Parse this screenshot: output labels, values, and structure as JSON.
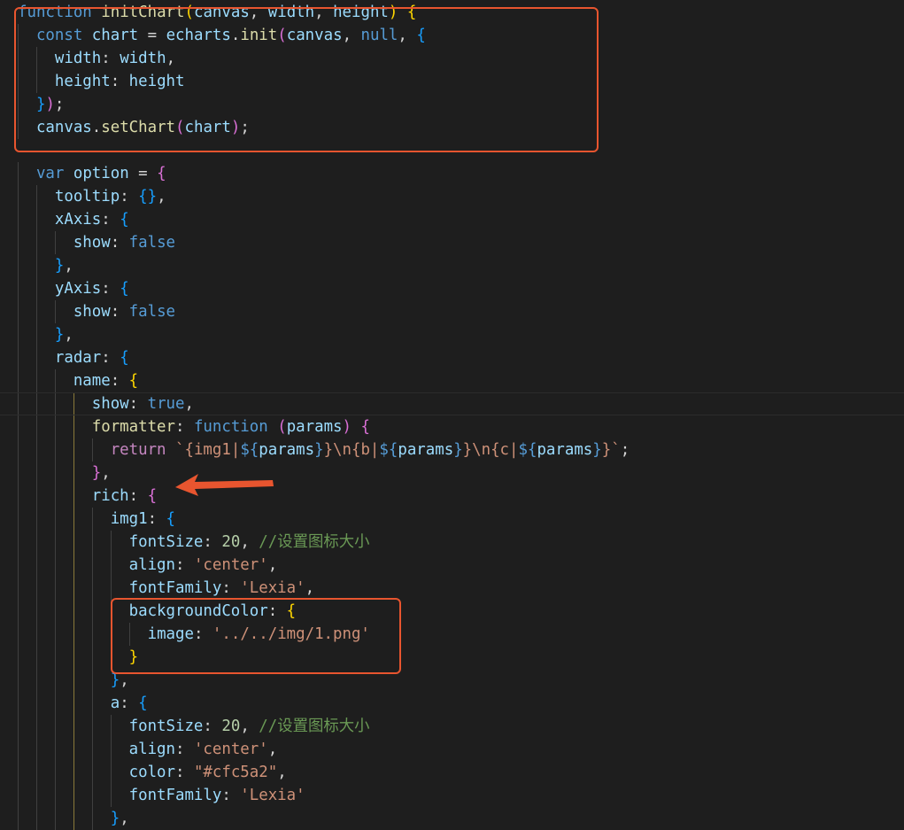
{
  "editor": {
    "theme_colors": {
      "background": "#1e1e1e",
      "annotation": "#e8552f"
    },
    "lines": [
      {
        "i": 0,
        "tokens": [
          [
            "function",
            "kw"
          ],
          [
            " ",
            "p"
          ],
          [
            "initChart",
            "fn"
          ],
          [
            "(",
            "b1"
          ],
          [
            "canvas",
            "var"
          ],
          [
            ", ",
            "p"
          ],
          [
            "width",
            "var"
          ],
          [
            ", ",
            "p"
          ],
          [
            "height",
            "var"
          ],
          [
            ")",
            "b1"
          ],
          [
            " ",
            "p"
          ],
          [
            "{",
            "b1"
          ]
        ]
      },
      {
        "i": 1,
        "tokens": [
          [
            "const",
            "kw"
          ],
          [
            " ",
            "p"
          ],
          [
            "chart",
            "var"
          ],
          [
            " = ",
            "p"
          ],
          [
            "echarts",
            "var"
          ],
          [
            ".",
            "p"
          ],
          [
            "init",
            "fn"
          ],
          [
            "(",
            "b2"
          ],
          [
            "canvas",
            "var"
          ],
          [
            ", ",
            "p"
          ],
          [
            "null",
            "kw"
          ],
          [
            ", ",
            "p"
          ],
          [
            "{",
            "b3"
          ]
        ]
      },
      {
        "i": 2,
        "tokens": [
          [
            "width",
            "prop"
          ],
          [
            ": ",
            "p"
          ],
          [
            "width",
            "var"
          ],
          [
            ",",
            "p"
          ]
        ]
      },
      {
        "i": 2,
        "tokens": [
          [
            "height",
            "prop"
          ],
          [
            ": ",
            "p"
          ],
          [
            "height",
            "var"
          ]
        ]
      },
      {
        "i": 1,
        "tokens": [
          [
            "}",
            "b3"
          ],
          [
            ")",
            "b2"
          ],
          [
            ";",
            "p"
          ]
        ]
      },
      {
        "i": 1,
        "tokens": [
          [
            "canvas",
            "var"
          ],
          [
            ".",
            "p"
          ],
          [
            "setChart",
            "fn"
          ],
          [
            "(",
            "b2"
          ],
          [
            "chart",
            "var"
          ],
          [
            ")",
            "b2"
          ],
          [
            ";",
            "p"
          ]
        ]
      },
      {
        "i": 0,
        "tokens": []
      },
      {
        "i": 1,
        "tokens": [
          [
            "var",
            "kw"
          ],
          [
            " ",
            "p"
          ],
          [
            "option",
            "var"
          ],
          [
            " = ",
            "p"
          ],
          [
            "{",
            "b2"
          ]
        ]
      },
      {
        "i": 2,
        "tokens": [
          [
            "tooltip",
            "prop"
          ],
          [
            ": ",
            "p"
          ],
          [
            "{}",
            "b3"
          ],
          [
            ",",
            "p"
          ]
        ]
      },
      {
        "i": 2,
        "tokens": [
          [
            "xAxis",
            "prop"
          ],
          [
            ": ",
            "p"
          ],
          [
            "{",
            "b3"
          ]
        ]
      },
      {
        "i": 3,
        "tokens": [
          [
            "show",
            "prop"
          ],
          [
            ": ",
            "p"
          ],
          [
            "false",
            "kw"
          ]
        ]
      },
      {
        "i": 2,
        "tokens": [
          [
            "}",
            "b3"
          ],
          [
            ",",
            "p"
          ]
        ]
      },
      {
        "i": 2,
        "tokens": [
          [
            "yAxis",
            "prop"
          ],
          [
            ": ",
            "p"
          ],
          [
            "{",
            "b3"
          ]
        ]
      },
      {
        "i": 3,
        "tokens": [
          [
            "show",
            "prop"
          ],
          [
            ": ",
            "p"
          ],
          [
            "false",
            "kw"
          ]
        ]
      },
      {
        "i": 2,
        "tokens": [
          [
            "}",
            "b3"
          ],
          [
            ",",
            "p"
          ]
        ]
      },
      {
        "i": 2,
        "tokens": [
          [
            "radar",
            "prop"
          ],
          [
            ": ",
            "p"
          ],
          [
            "{",
            "b3"
          ]
        ]
      },
      {
        "i": 3,
        "tokens": [
          [
            "name",
            "prop"
          ],
          [
            ": ",
            "p"
          ],
          [
            "{",
            "b1"
          ]
        ]
      },
      {
        "i": 4,
        "tokens": [
          [
            "show",
            "prop"
          ],
          [
            ": ",
            "p"
          ],
          [
            "true",
            "kw"
          ],
          [
            ",",
            "p"
          ]
        ],
        "current": true
      },
      {
        "i": 4,
        "tokens": [
          [
            "formatter",
            "fn"
          ],
          [
            ": ",
            "p"
          ],
          [
            "function",
            "kw"
          ],
          [
            " ",
            "p"
          ],
          [
            "(",
            "b2"
          ],
          [
            "params",
            "var"
          ],
          [
            ")",
            "b2"
          ],
          [
            " ",
            "p"
          ],
          [
            "{",
            "b2"
          ]
        ]
      },
      {
        "i": 5,
        "tokens": [
          [
            "return",
            "ret"
          ],
          [
            " ",
            "p"
          ],
          [
            "`{img1|",
            "str"
          ],
          [
            "${",
            "kw"
          ],
          [
            "params",
            "var"
          ],
          [
            "}",
            "kw"
          ],
          [
            "}\\n{b|",
            "str"
          ],
          [
            "${",
            "kw"
          ],
          [
            "params",
            "var"
          ],
          [
            "}",
            "kw"
          ],
          [
            "}\\n{c|",
            "str"
          ],
          [
            "${",
            "kw"
          ],
          [
            "params",
            "var"
          ],
          [
            "}",
            "kw"
          ],
          [
            "}`",
            "str"
          ],
          [
            ";",
            "p"
          ]
        ]
      },
      {
        "i": 4,
        "tokens": [
          [
            "}",
            "b2"
          ],
          [
            ",",
            "p"
          ]
        ]
      },
      {
        "i": 4,
        "tokens": [
          [
            "rich",
            "prop"
          ],
          [
            ": ",
            "p"
          ],
          [
            "{",
            "b2"
          ]
        ]
      },
      {
        "i": 5,
        "tokens": [
          [
            "img1",
            "prop"
          ],
          [
            ": ",
            "p"
          ],
          [
            "{",
            "b3"
          ]
        ]
      },
      {
        "i": 6,
        "tokens": [
          [
            "fontSize",
            "prop"
          ],
          [
            ": ",
            "p"
          ],
          [
            "20",
            "num"
          ],
          [
            ", ",
            "p"
          ],
          [
            "//设置图标大小",
            "com"
          ]
        ]
      },
      {
        "i": 6,
        "tokens": [
          [
            "align",
            "prop"
          ],
          [
            ": ",
            "p"
          ],
          [
            "'center'",
            "str"
          ],
          [
            ",",
            "p"
          ]
        ]
      },
      {
        "i": 6,
        "tokens": [
          [
            "fontFamily",
            "prop"
          ],
          [
            ": ",
            "p"
          ],
          [
            "'Lexia'",
            "str"
          ],
          [
            ",",
            "p"
          ]
        ]
      },
      {
        "i": 6,
        "tokens": [
          [
            "backgroundColor",
            "prop"
          ],
          [
            ": ",
            "p"
          ],
          [
            "{",
            "b1"
          ]
        ]
      },
      {
        "i": 7,
        "tokens": [
          [
            "image",
            "prop"
          ],
          [
            ": ",
            "p"
          ],
          [
            "'../../img/1.png'",
            "str"
          ]
        ]
      },
      {
        "i": 6,
        "tokens": [
          [
            "}",
            "b1"
          ]
        ]
      },
      {
        "i": 5,
        "tokens": [
          [
            "}",
            "b3"
          ],
          [
            ",",
            "p"
          ]
        ]
      },
      {
        "i": 5,
        "tokens": [
          [
            "a",
            "prop"
          ],
          [
            ": ",
            "p"
          ],
          [
            "{",
            "b3"
          ]
        ]
      },
      {
        "i": 6,
        "tokens": [
          [
            "fontSize",
            "prop"
          ],
          [
            ": ",
            "p"
          ],
          [
            "20",
            "num"
          ],
          [
            ", ",
            "p"
          ],
          [
            "//设置图标大小",
            "com"
          ]
        ]
      },
      {
        "i": 6,
        "tokens": [
          [
            "align",
            "prop"
          ],
          [
            ": ",
            "p"
          ],
          [
            "'center'",
            "str"
          ],
          [
            ",",
            "p"
          ]
        ]
      },
      {
        "i": 6,
        "tokens": [
          [
            "color",
            "prop"
          ],
          [
            ": ",
            "p"
          ],
          [
            "\"#cfc5a2\"",
            "str"
          ],
          [
            ",",
            "p"
          ]
        ]
      },
      {
        "i": 6,
        "tokens": [
          [
            "fontFamily",
            "prop"
          ],
          [
            ": ",
            "p"
          ],
          [
            "'Lexia'",
            "str"
          ]
        ]
      },
      {
        "i": 5,
        "tokens": [
          [
            "}",
            "b3"
          ],
          [
            ",",
            "p"
          ]
        ]
      }
    ]
  }
}
